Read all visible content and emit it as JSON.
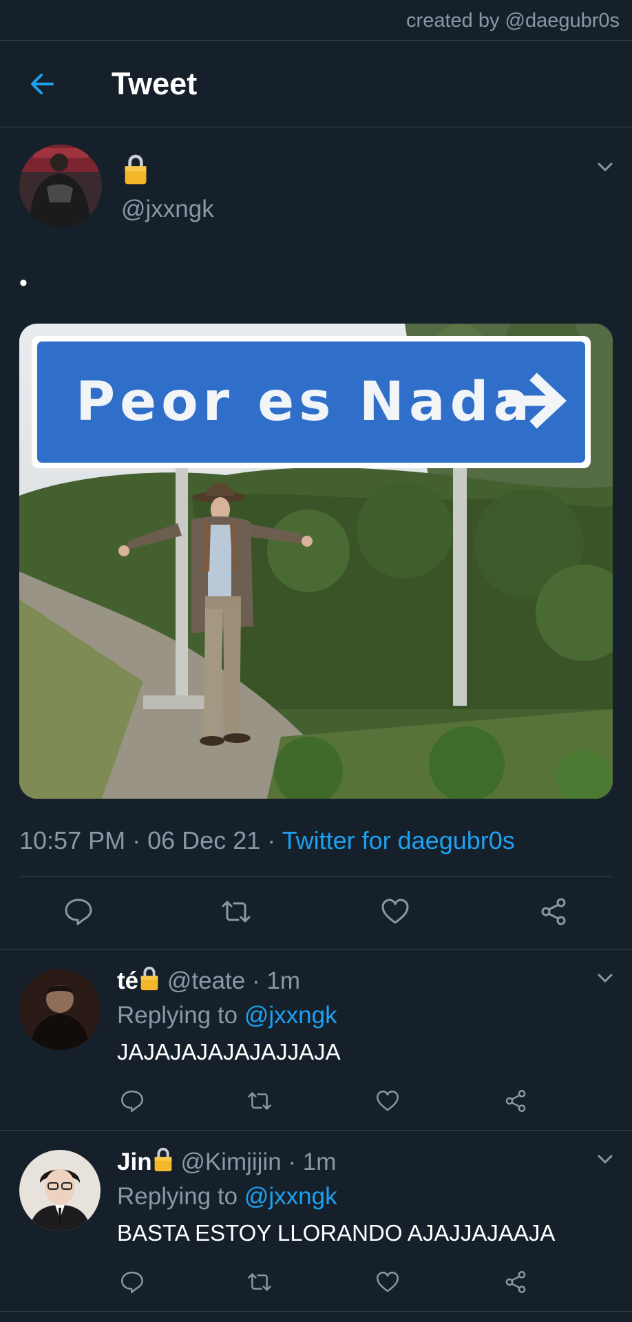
{
  "credit": "created by @daegubr0s",
  "header": {
    "title": "Tweet"
  },
  "main_tweet": {
    "handle": "@jxxngk",
    "text": "•",
    "image": {
      "sign_text": "Peor es Nada"
    },
    "time": "10:57 PM",
    "date": "06 Dec 21",
    "dot": "·",
    "source": "Twitter for daegubr0s"
  },
  "replies": [
    {
      "name": "té",
      "handle": "@teate",
      "time": "· 1m",
      "replying_label": "Replying to",
      "replying_to": "@jxxngk",
      "text": "JAJAJAJAJAJAJJAJA"
    },
    {
      "name": "Jin",
      "handle": "@Kimjijin",
      "time": "· 1m",
      "replying_label": "Replying to",
      "replying_to": "@jxxngk",
      "text": "BASTA ESTOY LLORANDO AJAJJAJAAJA"
    }
  ],
  "colors": {
    "background": "#15202b",
    "accent": "#1da1f2",
    "muted": "#8899a6",
    "divider": "#38444d"
  },
  "icons": [
    "back-arrow-icon",
    "lock-icon",
    "chevron-down-icon",
    "reply-icon",
    "retweet-icon",
    "like-icon",
    "share-icon"
  ]
}
